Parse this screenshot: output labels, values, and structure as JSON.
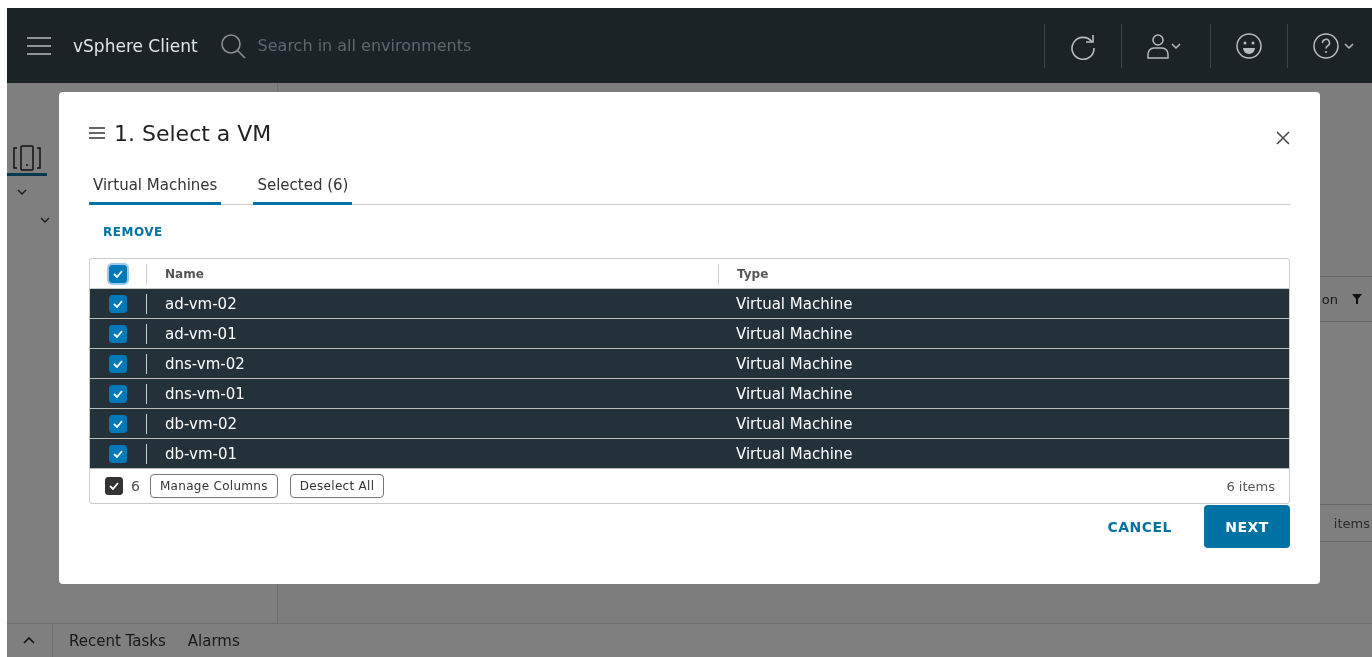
{
  "header": {
    "app_title": "vSphere Client",
    "search": {
      "placeholder": "Search in all environments"
    }
  },
  "background": {
    "column_fragment": "on",
    "footer_fragment": "items"
  },
  "bottom_bar": {
    "tabs": [
      {
        "label": "Recent Tasks"
      },
      {
        "label": "Alarms"
      }
    ]
  },
  "dialog": {
    "title": "1. Select a VM",
    "tabs": [
      {
        "label": "Virtual Machines",
        "selected": true
      },
      {
        "label": "Selected (6)",
        "selected": true
      }
    ],
    "action": "REMOVE",
    "table": {
      "select_all_checked": true,
      "columns": [
        "Name",
        "Type"
      ],
      "rows": [
        {
          "name": "ad-vm-02",
          "type": "Virtual Machine",
          "checked": true,
          "selected": true
        },
        {
          "name": "ad-vm-01",
          "type": "Virtual Machine",
          "checked": true,
          "selected": true
        },
        {
          "name": "dns-vm-02",
          "type": "Virtual Machine",
          "checked": true,
          "selected": true
        },
        {
          "name": "dns-vm-01",
          "type": "Virtual Machine",
          "checked": true,
          "selected": true
        },
        {
          "name": "db-vm-02",
          "type": "Virtual Machine",
          "checked": true,
          "selected": true
        },
        {
          "name": "db-vm-01",
          "type": "Virtual Machine",
          "checked": true,
          "selected": true
        }
      ]
    },
    "footer": {
      "selected_checked": true,
      "selected_count": "6",
      "buttons": [
        "Manage Columns",
        "Deselect All"
      ],
      "item_count": "6 items"
    },
    "buttons": {
      "cancel": "CANCEL",
      "next": "NEXT"
    }
  }
}
